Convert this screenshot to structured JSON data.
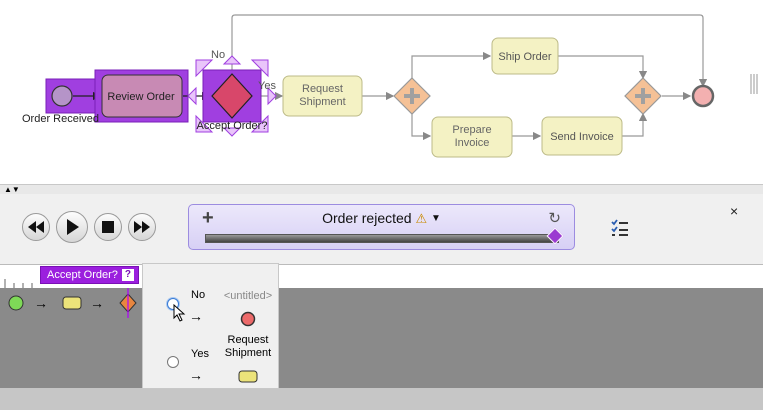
{
  "diagram": {
    "labels": {
      "order_received": "Order Received",
      "review_order": "Review Order",
      "accept_order": "Accept Order?",
      "request_shipment": "Request Shipment",
      "ship_order": "Ship Order",
      "prepare_invoice": "Prepare Invoice",
      "send_invoice": "Send Invoice",
      "flow_no": "No",
      "flow_yes": "Yes"
    },
    "colors": {
      "task_fill": "#f4f2c4",
      "gateway_fill": "#f5c196",
      "highlight": "#a03fe0",
      "selected_gateway": "#d8476a",
      "end_event": "#f3b0b0"
    }
  },
  "controls": {
    "rewind_icon": "rewind-icon",
    "play_icon": "play-icon",
    "stop_icon": "stop-icon",
    "fast_forward_icon": "fast-forward-icon",
    "simulation_title": "Order rejected",
    "add_icon": "plus-icon",
    "refresh_icon": "refresh-icon",
    "warning_icon": "warning-icon",
    "progress_fraction": 0.99,
    "close_label": "×",
    "tasklist_icon": "checklist-icon"
  },
  "timeline": {
    "current_badge": "Accept Order?",
    "help_mark": "?",
    "choices_popup": {
      "option_no": "No",
      "option_yes": "Yes",
      "no_target": "<untitled>",
      "yes_target": "Request Shipment",
      "selected": "No"
    }
  }
}
